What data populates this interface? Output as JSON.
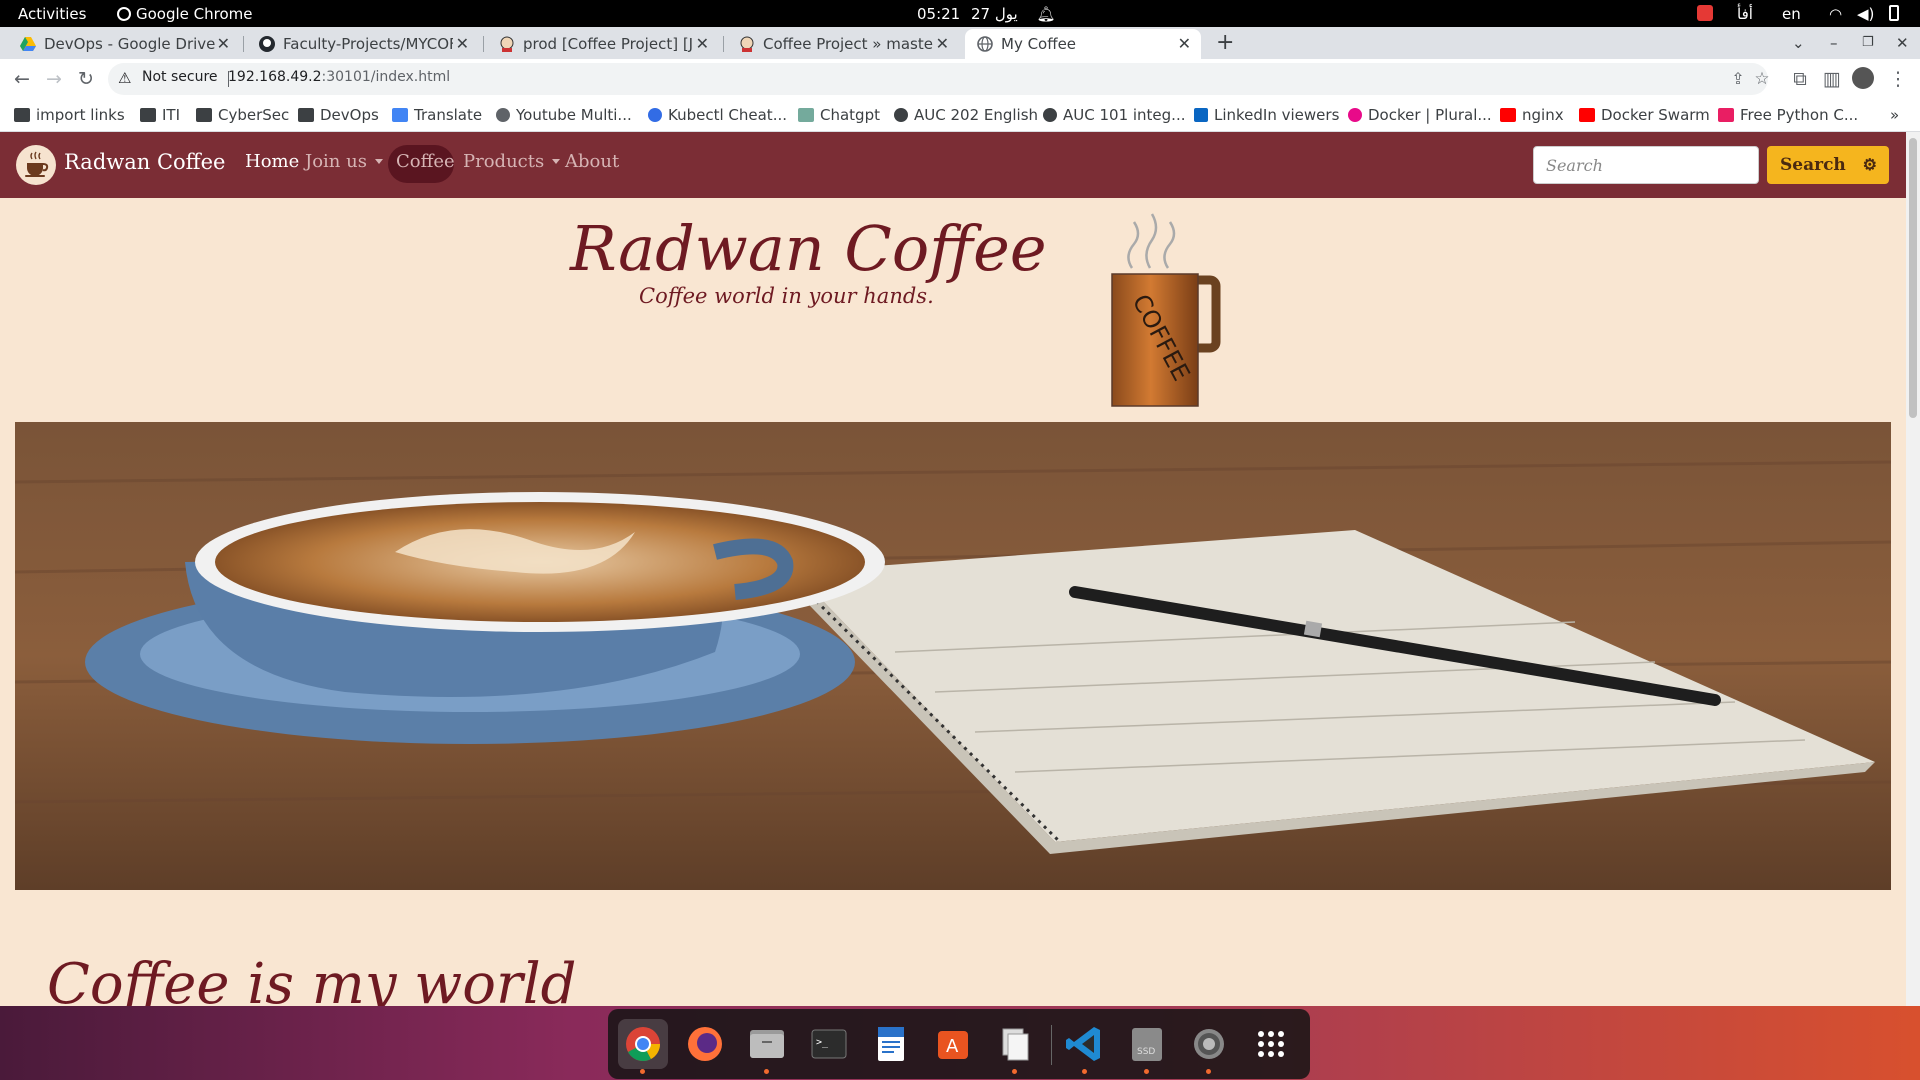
{
  "system": {
    "activities": "Activities",
    "app_name": "Google Chrome",
    "clock_time": "05:21",
    "clock_date": "27 يول",
    "keyboard_layout": "en",
    "input_method": "أفأ"
  },
  "tabs": [
    {
      "label": "DevOps - Google Drive",
      "icon": "google-drive-icon"
    },
    {
      "label": "Faculty-Projects/MYCOFFEE",
      "icon": "github-icon"
    },
    {
      "label": "prod [Coffee Project] [Jenkins]",
      "icon": "jenkins-icon"
    },
    {
      "label": "Coffee Project » master #",
      "icon": "jenkins-icon"
    },
    {
      "label": "My Coffee",
      "icon": "globe-icon",
      "active": true
    }
  ],
  "omnibox": {
    "security_label": "Not secure",
    "url_host": "192.168.49.2",
    "url_rest": ":30101/index.html"
  },
  "bookmarks": [
    {
      "label": "import links",
      "icon": "folder-icon"
    },
    {
      "label": "ITI",
      "icon": "folder-icon"
    },
    {
      "label": "CyberSec",
      "icon": "folder-icon"
    },
    {
      "label": "DevOps",
      "icon": "folder-icon"
    },
    {
      "label": "Translate",
      "icon": "translate-icon"
    },
    {
      "label": "Youtube Multi...",
      "icon": "globe-icon"
    },
    {
      "label": "Kubectl Cheat...",
      "icon": "kubernetes-icon"
    },
    {
      "label": "Chatgpt",
      "icon": "chatgpt-icon"
    },
    {
      "label": "AUC 202 English",
      "icon": "moodle-icon"
    },
    {
      "label": "AUC 101 integ...",
      "icon": "moodle-icon"
    },
    {
      "label": "LinkedIn viewers",
      "icon": "linkedin-icon"
    },
    {
      "label": "Docker | Plural...",
      "icon": "pluralsight-icon"
    },
    {
      "label": "nginx",
      "icon": "youtube-icon"
    },
    {
      "label": "Docker Swarm",
      "icon": "youtube-icon"
    },
    {
      "label": "Free Python C...",
      "icon": "gem-icon"
    }
  ],
  "site": {
    "brand": "Radwan Coffee",
    "nav": {
      "home": "Home",
      "join_us": "Join us",
      "coffee": "Coffee",
      "products": "Products",
      "about": "About"
    },
    "search_placeholder": "Search",
    "search_button": "Search",
    "title": "Radwan Coffee",
    "subtitle": "Coffee world in your hands.",
    "mug_text": "COFFEE",
    "section_title": "Coffee is my world"
  },
  "dock": [
    {
      "name": "chrome-icon",
      "running": true
    },
    {
      "name": "firefox-icon",
      "running": false
    },
    {
      "name": "files-icon",
      "running": true
    },
    {
      "name": "terminal-icon",
      "running": false
    },
    {
      "name": "writer-icon",
      "running": false
    },
    {
      "name": "app-center-icon",
      "running": false
    },
    {
      "name": "clipboard-icon",
      "running": true
    },
    {
      "name": "vscode-icon",
      "running": true
    },
    {
      "name": "ssd-icon",
      "running": true
    },
    {
      "name": "settings-icon",
      "running": true
    },
    {
      "name": "show-apps-icon",
      "running": false
    }
  ],
  "colors": {
    "navbar": "#7b2d35",
    "page_bg": "#f9e6d2",
    "heading": "#6e1a22",
    "search_button": "#f5b51e"
  }
}
